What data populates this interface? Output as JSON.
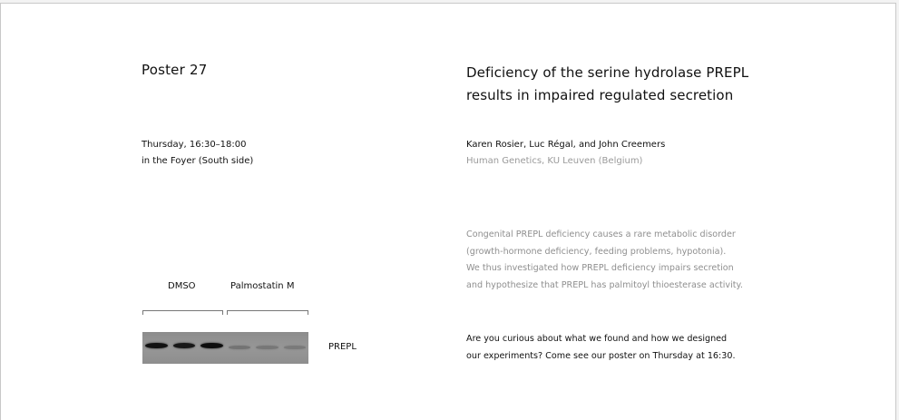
{
  "left": {
    "poster_number": "Poster 27",
    "session_time": "Thursday, 16:30–18:00",
    "session_location": "in the Foyer (South side)"
  },
  "figure": {
    "lane_groups": [
      "DMSO",
      "Palmostatin M"
    ],
    "band_label": "PREPL",
    "band_intensity": [
      0.95,
      0.9,
      0.98,
      0.25,
      0.22,
      0.2
    ]
  },
  "right": {
    "title_line1": "Deficiency of the serine hydrolase PREPL",
    "title_line2": "results in impaired regulated secretion",
    "authors": "Karen Rosier, Luc Régal, and John Creemers",
    "affiliation": "Human Genetics, KU Leuven (Belgium)",
    "abstract_lines": [
      "Congenital PREPL deficiency causes a rare metabolic disorder",
      "(growth-hormone deficiency, feeding problems, hypotonia).",
      "We thus investigated how PREPL deficiency impairs secretion",
      "and hypothesize that PREPL has palmitoyl thioesterase activity."
    ],
    "question_lines": [
      "Are you curious about what we found and how we designed",
      "our experiments? Come see our poster on Thursday at 16:30."
    ]
  }
}
